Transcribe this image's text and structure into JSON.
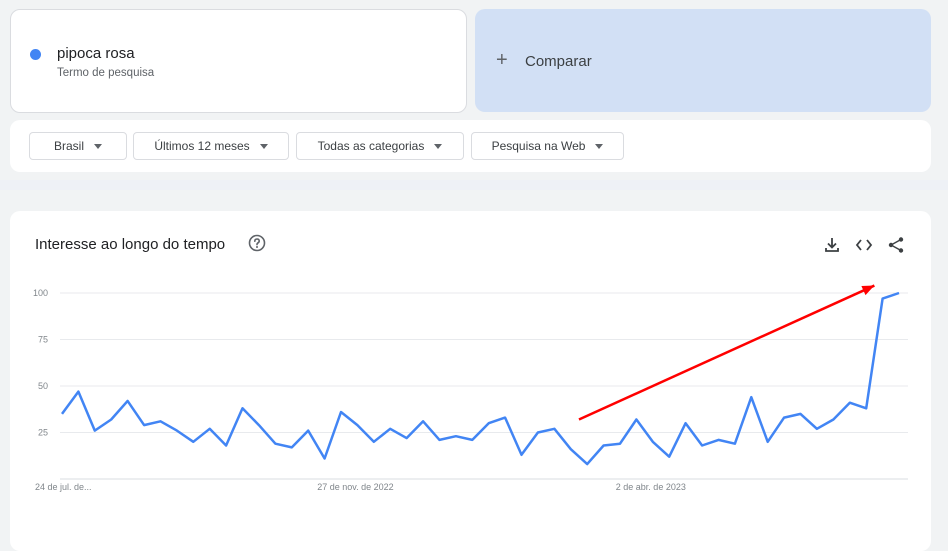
{
  "search": {
    "term": "pipoca rosa",
    "term_type": "Termo de pesquisa",
    "term_color": "#4285f4",
    "compare_label": "Comparar"
  },
  "filters": [
    {
      "label": "Brasil"
    },
    {
      "label": "Últimos 12 meses"
    },
    {
      "label": "Todas as categorias"
    },
    {
      "label": "Pesquisa na Web"
    }
  ],
  "chart_card": {
    "title": "Interesse ao longo do tempo",
    "icons": [
      "help-icon",
      "download-icon",
      "embed-icon",
      "share-icon"
    ]
  },
  "chart_data": {
    "type": "line",
    "title": "",
    "xlabel": "",
    "ylabel": "",
    "ylim": [
      0,
      100
    ],
    "yticks": [
      25,
      50,
      75,
      100
    ],
    "grid": true,
    "x_tick_labels": [
      {
        "index": 0,
        "label": "24 de jul. de..."
      },
      {
        "index": 18,
        "label": "27 de nov. de 2022"
      },
      {
        "index": 36,
        "label": "2 de abr. de 2023"
      }
    ],
    "series": [
      {
        "color": "#4285f4",
        "values": [
          35,
          47,
          26,
          32,
          42,
          29,
          31,
          26,
          20,
          27,
          18,
          38,
          29,
          19,
          17,
          26,
          11,
          36,
          29,
          20,
          27,
          22,
          31,
          21,
          23,
          21,
          30,
          33,
          13,
          25,
          27,
          16,
          8,
          18,
          19,
          32,
          20,
          12,
          30,
          18,
          21,
          19,
          44,
          20,
          33,
          35,
          27,
          32,
          41,
          38,
          97,
          100
        ]
      }
    ],
    "annotations": [
      {
        "type": "arrow",
        "color": "#ff0000",
        "from_index": 31.5,
        "from_value": 32,
        "to_index": 49.5,
        "to_value": 104
      }
    ]
  }
}
